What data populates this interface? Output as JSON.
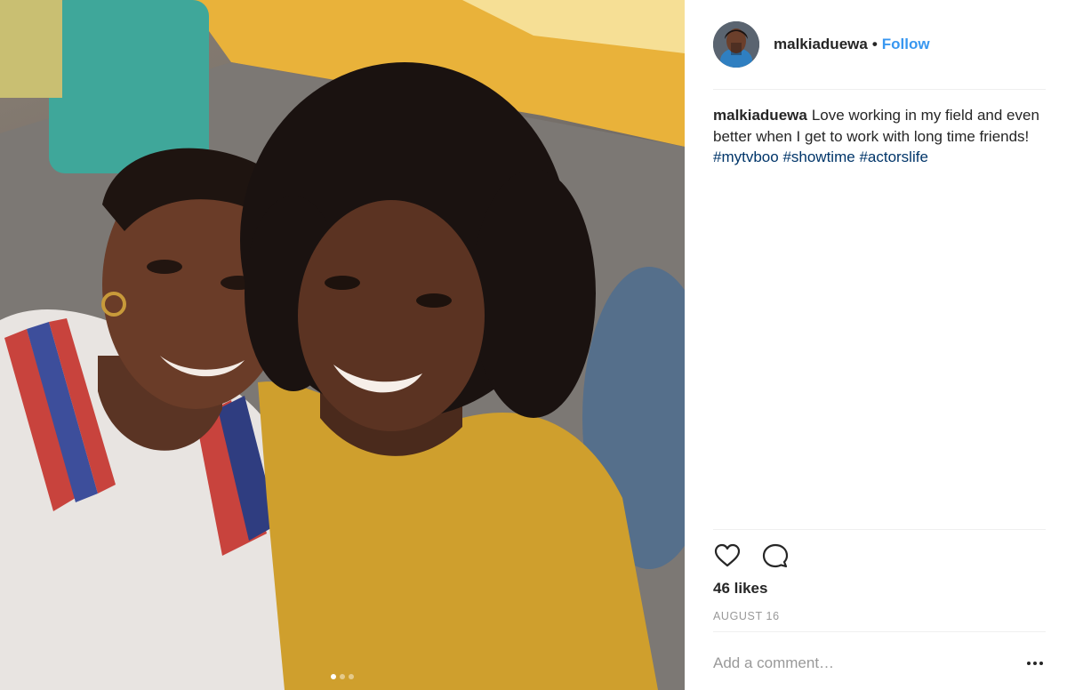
{
  "post": {
    "photo_label": "",
    "carousel": {
      "count": 3,
      "active_index": 0
    }
  },
  "header": {
    "username": "malkiaduewa",
    "separator": "•",
    "follow_label": "Follow"
  },
  "caption": {
    "username": "malkiaduewa",
    "text": "Love working in my field and even better when I get to work with long time friends!",
    "hashtags": [
      "#mytvboo",
      "#showtime",
      "#actorslife"
    ]
  },
  "actions": {
    "like_icon": "heart-icon",
    "comment_icon": "comment-bubble-icon"
  },
  "likes_label": "46 likes",
  "date_label": "AUGUST 16",
  "comment": {
    "placeholder": "Add a comment…",
    "more_icon": "more-options-icon"
  },
  "colors": {
    "follow": "#3897f0",
    "hashtag": "#003569",
    "muted": "#999999",
    "divider": "#efefef"
  }
}
